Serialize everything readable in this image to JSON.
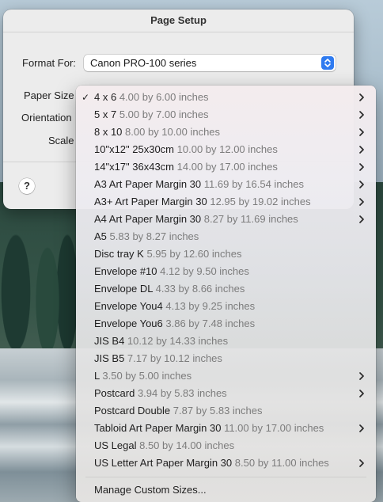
{
  "sheet": {
    "title": "Page Setup",
    "format_for_label": "Format For:",
    "printer": "Canon PRO-100 series",
    "paper_size_label": "Paper Size",
    "orientation_label": "Orientation",
    "scale_label": "Scale",
    "help_label": "?"
  },
  "menu": {
    "items": [
      {
        "name": "4 x 6",
        "dims": "4.00 by 6.00 inches",
        "checked": true,
        "submenu": true
      },
      {
        "name": "5 x 7",
        "dims": "5.00 by 7.00 inches",
        "checked": false,
        "submenu": true
      },
      {
        "name": "8 x 10",
        "dims": "8.00 by 10.00 inches",
        "checked": false,
        "submenu": true
      },
      {
        "name": "10\"x12\" 25x30cm",
        "dims": "10.00 by 12.00 inches",
        "checked": false,
        "submenu": true
      },
      {
        "name": "14\"x17\" 36x43cm",
        "dims": "14.00 by 17.00 inches",
        "checked": false,
        "submenu": true
      },
      {
        "name": "A3 Art Paper Margin 30",
        "dims": "11.69 by 16.54 inches",
        "checked": false,
        "submenu": true
      },
      {
        "name": "A3+ Art Paper Margin 30",
        "dims": "12.95 by 19.02 inches",
        "checked": false,
        "submenu": true
      },
      {
        "name": "A4 Art Paper Margin 30",
        "dims": "8.27 by 11.69 inches",
        "checked": false,
        "submenu": true
      },
      {
        "name": "A5",
        "dims": "5.83 by 8.27 inches",
        "checked": false,
        "submenu": false
      },
      {
        "name": "Disc tray K",
        "dims": "5.95 by 12.60 inches",
        "checked": false,
        "submenu": false
      },
      {
        "name": "Envelope #10",
        "dims": "4.12 by 9.50 inches",
        "checked": false,
        "submenu": false
      },
      {
        "name": "Envelope DL",
        "dims": "4.33 by 8.66 inches",
        "checked": false,
        "submenu": false
      },
      {
        "name": "Envelope You4",
        "dims": "4.13 by 9.25 inches",
        "checked": false,
        "submenu": false
      },
      {
        "name": "Envelope You6",
        "dims": "3.86 by 7.48 inches",
        "checked": false,
        "submenu": false
      },
      {
        "name": "JIS B4",
        "dims": "10.12 by 14.33 inches",
        "checked": false,
        "submenu": false
      },
      {
        "name": "JIS B5",
        "dims": "7.17 by 10.12 inches",
        "checked": false,
        "submenu": false
      },
      {
        "name": "L",
        "dims": "3.50 by 5.00 inches",
        "checked": false,
        "submenu": true
      },
      {
        "name": "Postcard",
        "dims": "3.94 by 5.83 inches",
        "checked": false,
        "submenu": true
      },
      {
        "name": "Postcard Double",
        "dims": "7.87 by 5.83 inches",
        "checked": false,
        "submenu": false
      },
      {
        "name": "Tabloid Art Paper Margin 30",
        "dims": "11.00 by 17.00 inches",
        "checked": false,
        "submenu": true
      },
      {
        "name": "US Legal",
        "dims": "8.50 by 14.00 inches",
        "checked": false,
        "submenu": false
      },
      {
        "name": "US Letter Art Paper Margin 30",
        "dims": "8.50 by 11.00 inches",
        "checked": false,
        "submenu": true
      }
    ],
    "manage_label": "Manage Custom Sizes..."
  }
}
